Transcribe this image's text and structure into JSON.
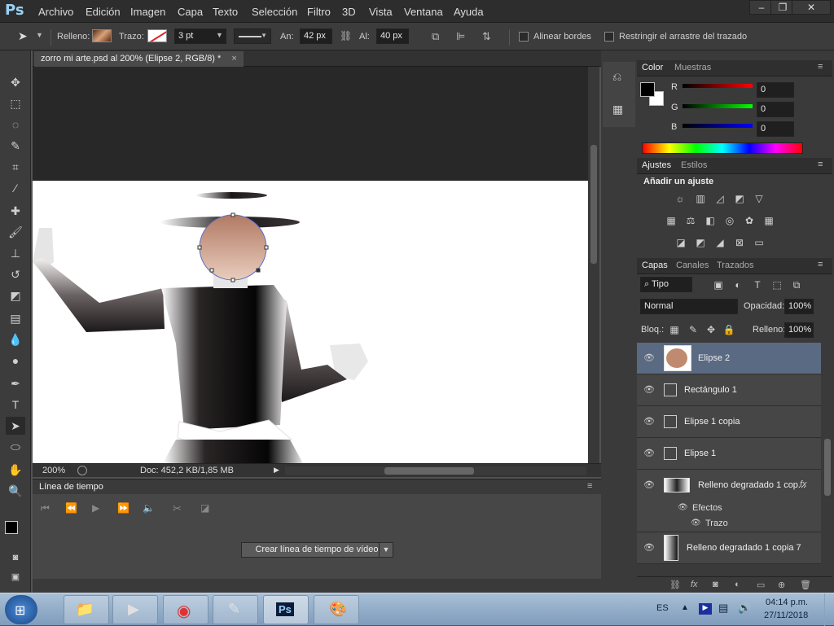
{
  "app": {
    "logo": "Ps"
  },
  "menu": [
    "Archivo",
    "Edición",
    "Imagen",
    "Capa",
    "Texto",
    "Selección",
    "Filtro",
    "3D",
    "Vista",
    "Ventana",
    "Ayuda"
  ],
  "window_controls": [
    "minimize-icon",
    "restore-icon",
    "close-icon"
  ],
  "options": {
    "fill_label": "Relleno:",
    "stroke_label": "Trazo:",
    "stroke_width": "3 pt",
    "width_label": "An:",
    "width_value": "42 px",
    "height_label": "Al:",
    "height_value": "40 px",
    "align_edges": "Alinear bordes",
    "constrain_path": "Restringir el arrastre del trazado"
  },
  "document": {
    "tab_title": "zorro mi arte.psd al 200% (Elipse 2, RGB/8) *"
  },
  "status": {
    "zoom": "200%",
    "doc": "Doc: 452,2 KB/1,85 MB"
  },
  "timeline": {
    "title": "Línea de tiempo",
    "create_button": "Crear línea de tiempo de vídeo"
  },
  "color_panel": {
    "tabs": [
      "Color",
      "Muestras"
    ],
    "channels": [
      {
        "label": "R",
        "value": "0"
      },
      {
        "label": "G",
        "value": "0"
      },
      {
        "label": "B",
        "value": "0"
      }
    ]
  },
  "adjust_panel": {
    "tabs": [
      "Ajustes",
      "Estilos"
    ],
    "heading": "Añadir un ajuste"
  },
  "layers_panel": {
    "tabs": [
      "Capas",
      "Canales",
      "Trazados"
    ],
    "kind_filter": "Tipo",
    "blend_mode": "Normal",
    "opacity_label": "Opacidad:",
    "opacity_value": "100%",
    "lock_label": "Bloq.:",
    "fill_label": "Relleno:",
    "fill_value": "100%",
    "layers": [
      {
        "name": "Elipse 2"
      },
      {
        "name": "Rectángulo 1"
      },
      {
        "name": "Elipse 1 copia"
      },
      {
        "name": "Elipse 1"
      },
      {
        "name": "Relleno degradado 1 cop...",
        "fx": "fx"
      },
      {
        "name": "Relleno degradado 1 copia 7"
      }
    ],
    "effects_label": "Efectos",
    "stroke_effect": "Trazo"
  },
  "taskbar": {
    "lang": "ES",
    "time": "04:14 p.m.",
    "date": "27/11/2018"
  }
}
